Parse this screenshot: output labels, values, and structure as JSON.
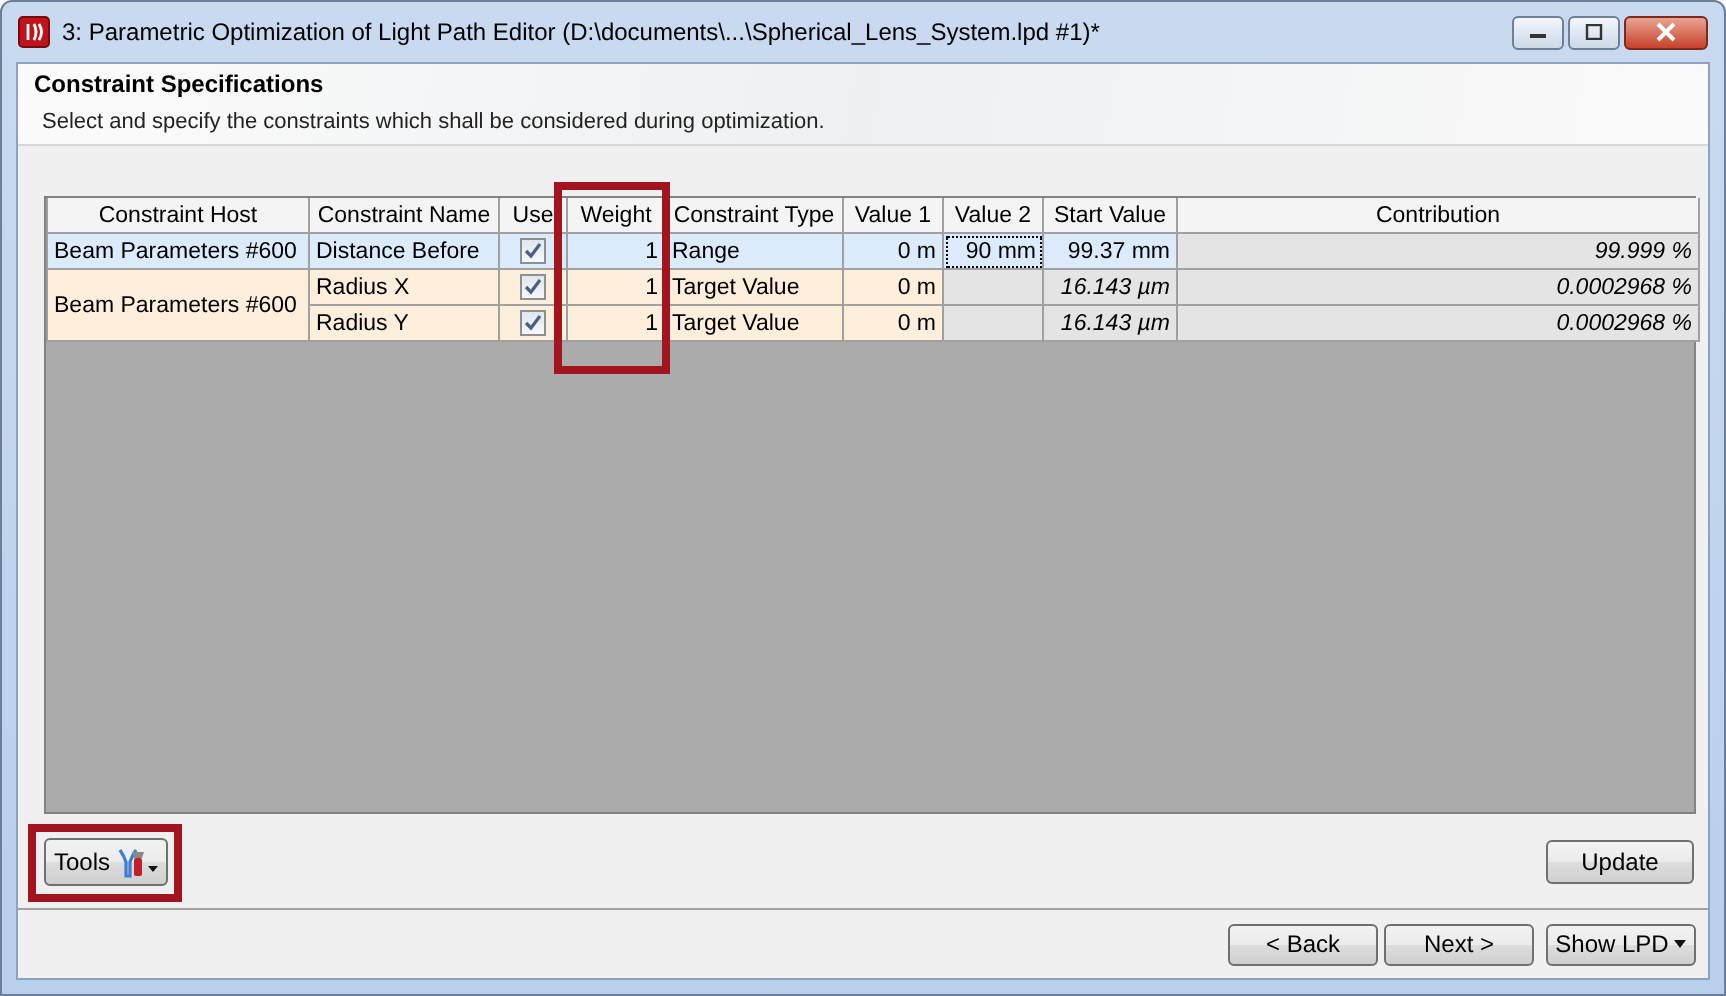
{
  "window": {
    "title": "3: Parametric Optimization of Light Path Editor (D:\\documents\\...\\Spherical_Lens_System.lpd #1)*"
  },
  "header": {
    "title": "Constraint Specifications",
    "description": "Select and specify the constraints which shall be considered during optimization."
  },
  "table": {
    "columns": [
      {
        "label": "Constraint Host",
        "highlighted": false
      },
      {
        "label": "Constraint Name",
        "highlighted": false
      },
      {
        "label": "Use",
        "highlighted": false
      },
      {
        "label": "Weight",
        "highlighted": true
      },
      {
        "label": "Constraint Type",
        "highlighted": false
      },
      {
        "label": "Value 1",
        "highlighted": false
      },
      {
        "label": "Value 2",
        "highlighted": false
      },
      {
        "label": "Start Value",
        "highlighted": false
      },
      {
        "label": "Contribution",
        "highlighted": false
      }
    ],
    "groups": [
      {
        "host": "Beam Parameters #600",
        "selected": true,
        "rows": [
          {
            "name": "Distance Before",
            "use": true,
            "weight": "1",
            "type": "Range",
            "value_1": "0 m",
            "value_2": "90 mm",
            "value_2_focused": true,
            "start_value": "99.37 mm",
            "start_computed": false,
            "contribution": "99.999 %"
          }
        ]
      },
      {
        "host": "Beam Parameters #600",
        "selected": false,
        "rows": [
          {
            "name": "Radius X",
            "use": true,
            "weight": "1",
            "type": "Target Value",
            "value_1": "0 m",
            "value_2_focused": false,
            "start_value": "16.143 µm",
            "start_computed": true,
            "contribution": "0.0002968 %"
          },
          {
            "name": "Radius Y",
            "use": true,
            "weight": "1",
            "type": "Target Value",
            "value_1": "0 m",
            "value_2_focused": false,
            "start_value": "16.143 µm",
            "start_computed": true,
            "contribution": "0.0002968 %"
          }
        ]
      }
    ]
  },
  "tools_button": {
    "label": "Tools",
    "highlighted": true
  },
  "update_button": {
    "label": "Update"
  },
  "nav_buttons": [
    {
      "label": "< Back",
      "kind": "plain"
    },
    {
      "label": "Next >",
      "kind": "plain"
    },
    {
      "label": "Show LPD",
      "kind": "dropdown"
    }
  ]
}
